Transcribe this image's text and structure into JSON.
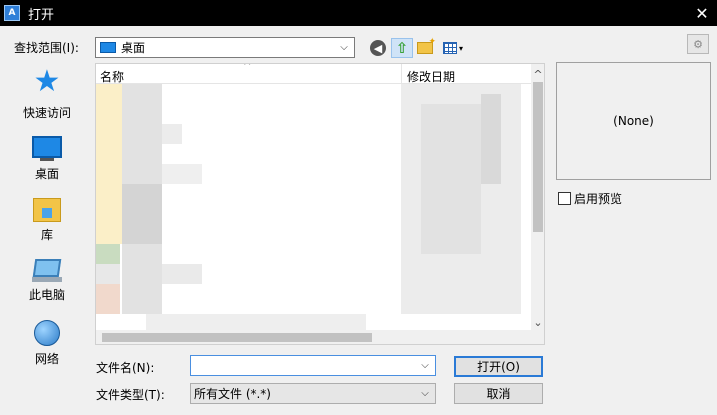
{
  "window": {
    "title": "打开",
    "app_icon_text": "A",
    "close": "✕"
  },
  "toolbar": {
    "look_in_label": "查找范围(I):",
    "look_in_value": "桌面",
    "dropdown_arrow": "⌵",
    "back_glyph": "◀",
    "up_glyph": "⇧",
    "view_dropdown_glyph": "▾",
    "tools_glyph": "⚙"
  },
  "places": [
    {
      "label": "快速访问",
      "icon": "star-icon"
    },
    {
      "label": "桌面",
      "icon": "desktop-icon"
    },
    {
      "label": "库",
      "icon": "library-icon"
    },
    {
      "label": "此电脑",
      "icon": "computer-icon"
    },
    {
      "label": "网络",
      "icon": "network-icon"
    }
  ],
  "file_list": {
    "columns": {
      "name": "名称",
      "date": "修改日期"
    },
    "sort_caret": "^",
    "scroll_up": "^",
    "scroll_down": "⌄"
  },
  "preview": {
    "none_text": "(None)",
    "checkbox_label": "启用预览"
  },
  "filename": {
    "label": "文件名(N):",
    "value": ""
  },
  "filetype": {
    "label": "文件类型(T):",
    "value": "所有文件 (*.*)"
  },
  "buttons": {
    "open": "打开(O)",
    "cancel": "取消"
  },
  "colors": {
    "titlebar": "#000000",
    "accent": "#1e88e5",
    "selection_border": "#2a7ad6"
  }
}
